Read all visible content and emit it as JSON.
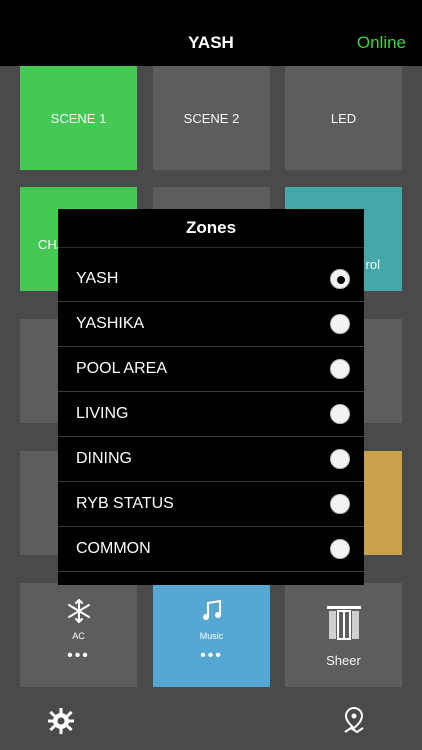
{
  "header": {
    "title": "YASH",
    "status": "Online"
  },
  "tiles": {
    "row1": [
      "SCENE 1",
      "SCENE 2",
      "LED"
    ],
    "row2": [
      "CHA",
      "",
      "rol"
    ],
    "row5": {
      "ac_label": "AC",
      "music_label": "Music",
      "sheer_label": "Sheer",
      "dots": "•••"
    }
  },
  "modal": {
    "title": "Zones",
    "options": [
      {
        "label": "YASH",
        "selected": true
      },
      {
        "label": "YASHIKA",
        "selected": false
      },
      {
        "label": "POOL AREA",
        "selected": false
      },
      {
        "label": "LIVING",
        "selected": false
      },
      {
        "label": "DINING",
        "selected": false
      },
      {
        "label": "RYB STATUS",
        "selected": false
      },
      {
        "label": "COMMON",
        "selected": false
      }
    ]
  },
  "icons": {
    "settings": "gear-icon",
    "location": "map-pin-icon",
    "ac": "snowflake-icon",
    "music": "music-note-icon",
    "sheer": "window-curtain-icon"
  },
  "colors": {
    "online": "#3fd43f",
    "green_tile": "#46c857",
    "teal_tile": "#46a7a8",
    "gold_tile": "#c9a24c",
    "blue_tile": "#56a8d3"
  }
}
